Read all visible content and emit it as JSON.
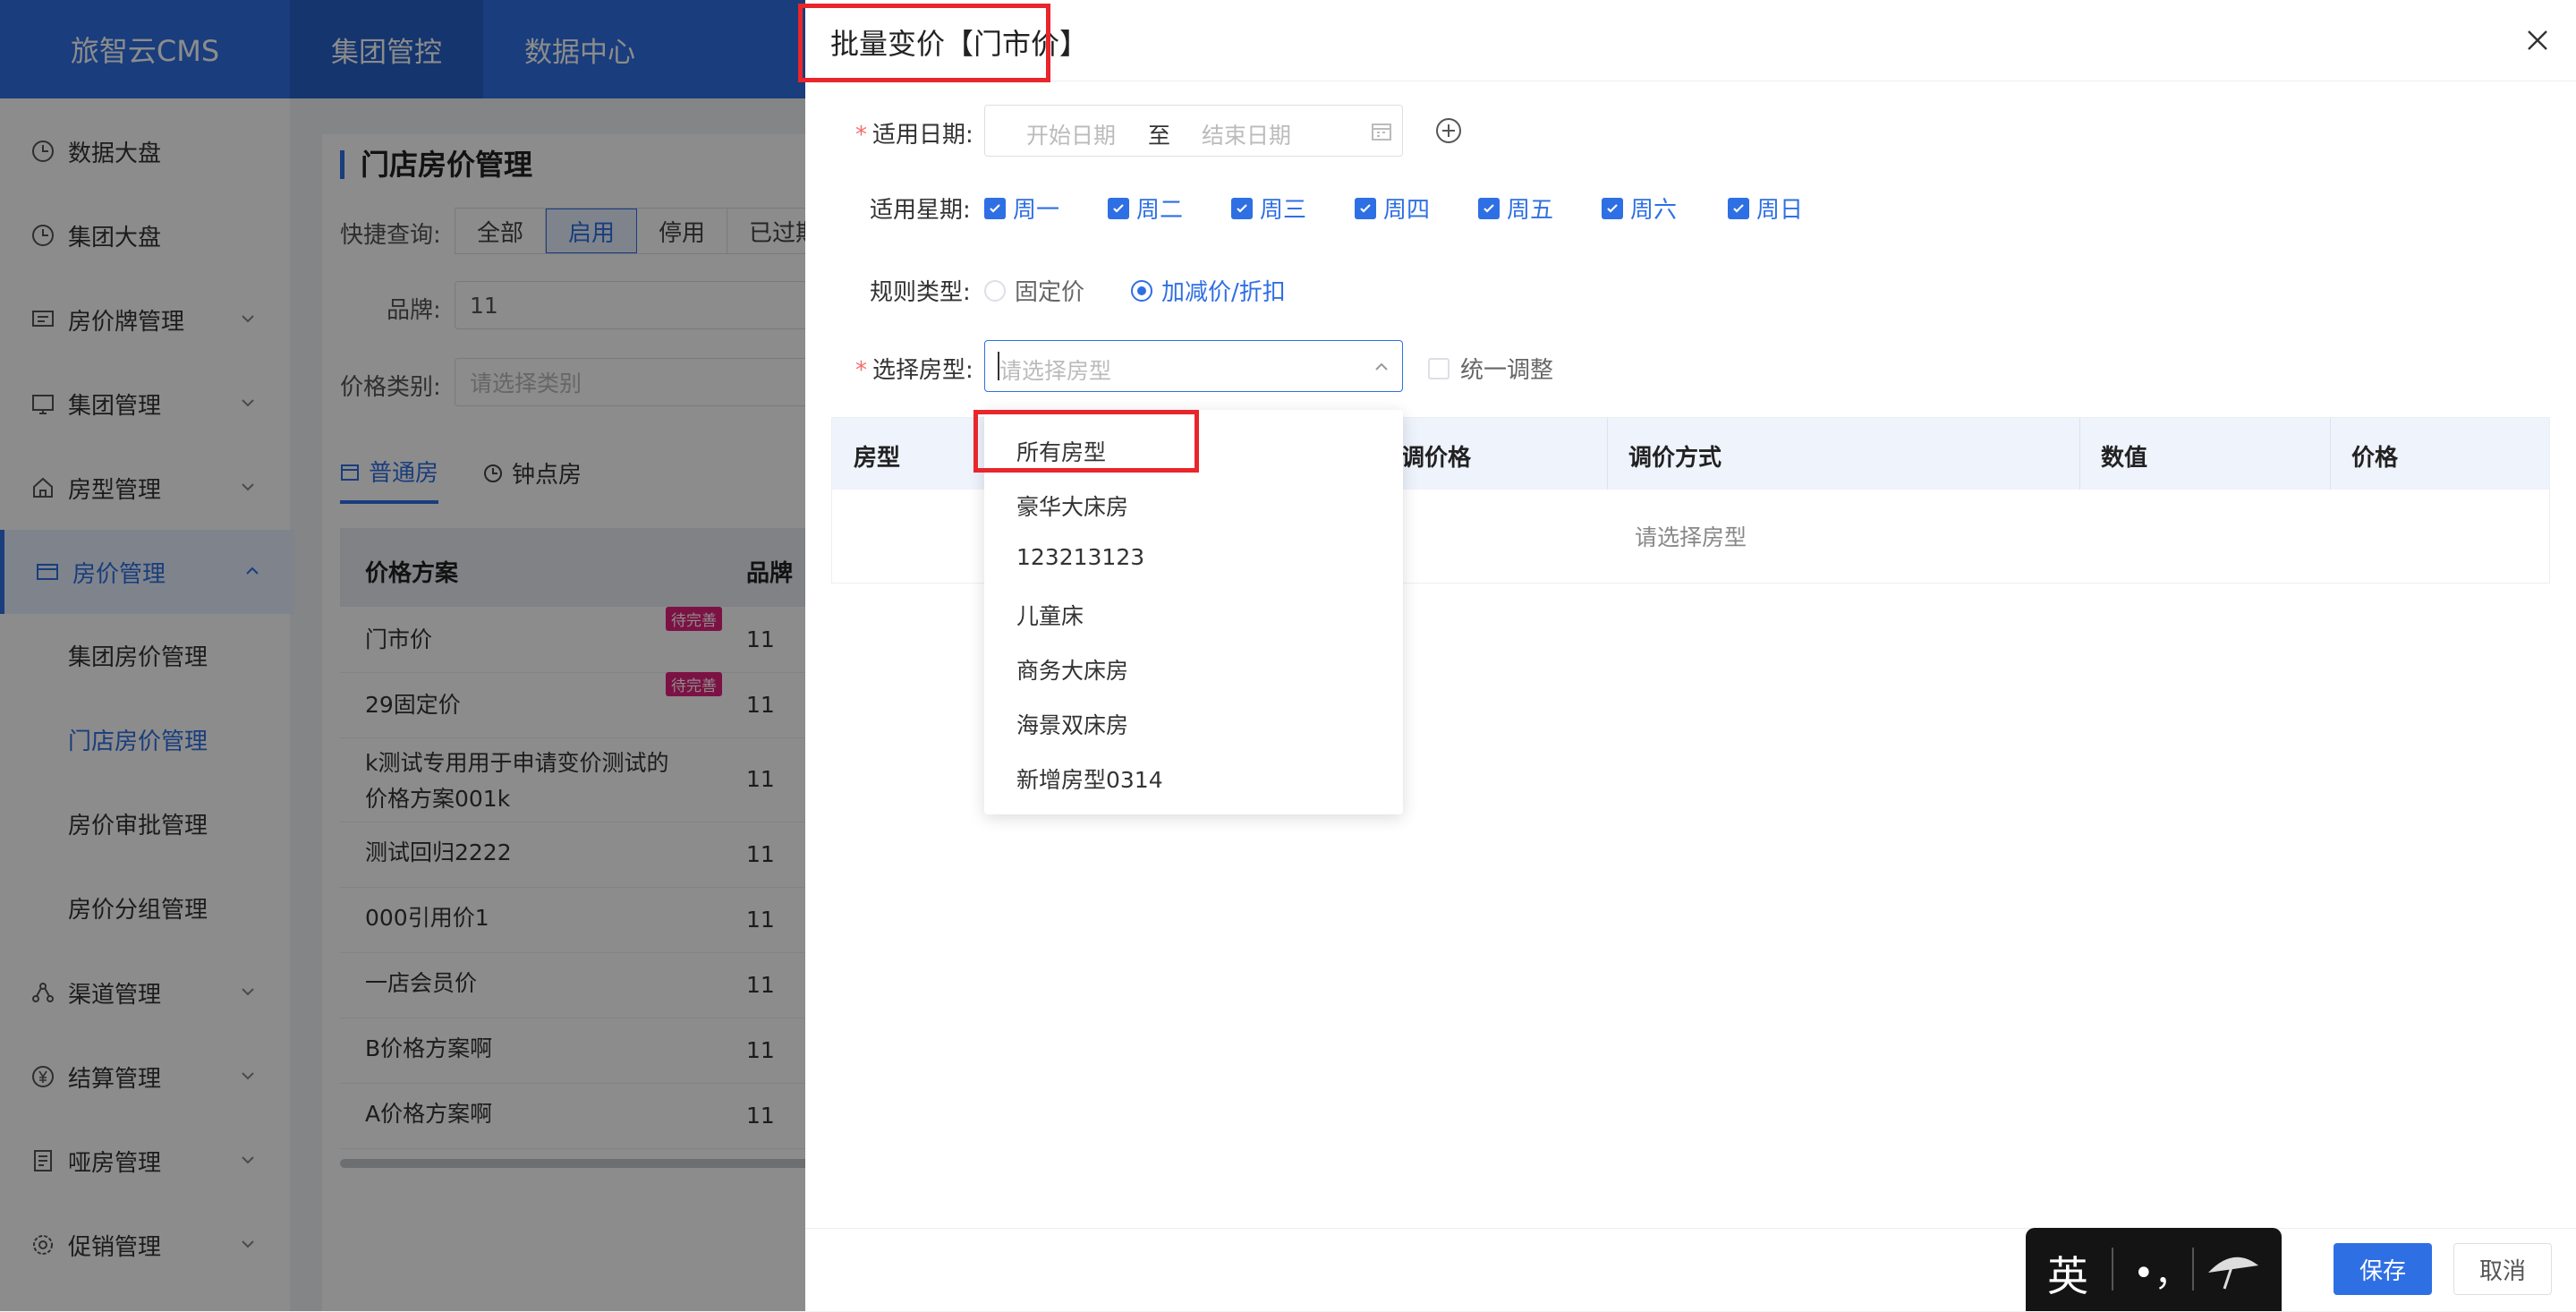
{
  "app": {
    "brand": "旅智云CMS",
    "top_nav": [
      "集团管控",
      "数据中心"
    ]
  },
  "sidebar": {
    "items": [
      {
        "label": "数据大盘",
        "icon": "clock-icon"
      },
      {
        "label": "集团大盘",
        "icon": "clock-icon"
      },
      {
        "label": "房价牌管理",
        "icon": "board-icon",
        "chevron": true
      },
      {
        "label": "集团管理",
        "icon": "board-icon",
        "chevron": true
      },
      {
        "label": "房型管理",
        "icon": "home-icon",
        "chevron": true
      },
      {
        "label": "房价管理",
        "icon": "card-icon",
        "chevron": true,
        "active": true
      },
      {
        "label": "渠道管理",
        "icon": "network-icon",
        "chevron": true
      },
      {
        "label": "结算管理",
        "icon": "yen-icon",
        "chevron": true
      },
      {
        "label": "哑房管理",
        "icon": "document-icon",
        "chevron": true
      },
      {
        "label": "促销管理",
        "icon": "gear-icon",
        "chevron": true
      }
    ],
    "sub_items": [
      "集团房价管理",
      "门店房价管理",
      "房价审批管理",
      "房价分组管理"
    ]
  },
  "main": {
    "title": "门店房价管理",
    "quick_label": "快捷查询:",
    "quick_filters": [
      "全部",
      "启用",
      "停用",
      "已过期"
    ],
    "brand_label": "品牌:",
    "brand_value": "11",
    "category_label": "价格类别:",
    "category_placeholder": "请选择类别",
    "tabs": [
      "普通房",
      "钟点房"
    ],
    "columns": [
      "价格方案",
      "品牌"
    ],
    "rows": [
      {
        "name": "门市价",
        "brand": "11",
        "badge": "待完善"
      },
      {
        "name": "29固定价",
        "brand": "11",
        "badge": "待完善"
      },
      {
        "name": "k测试专用用于申请变价测试的",
        "name2": "价格方案001k",
        "brand": "11"
      },
      {
        "name": "测试回归2222",
        "brand": "11"
      },
      {
        "name": "000引用价1",
        "brand": "11"
      },
      {
        "name": "一店会员价",
        "brand": "11"
      },
      {
        "name": "B价格方案啊",
        "brand": "11"
      },
      {
        "name": "A价格方案啊",
        "brand": "11"
      }
    ]
  },
  "drawer": {
    "title": "批量变价【门市价】",
    "date_label": "适用日期:",
    "date_start_placeholder": "开始日期",
    "date_sep": "至",
    "date_end_placeholder": "结束日期",
    "weekday_label": "适用星期:",
    "weekdays": [
      "周一",
      "周二",
      "周三",
      "周四",
      "周五",
      "周六",
      "周日"
    ],
    "rule_label": "规则类型:",
    "rule_options": [
      "固定价",
      "加减价/折扣"
    ],
    "rule_selected": "加减价/折扣",
    "roomtype_label": "选择房型:",
    "roomtype_placeholder": "请选择房型",
    "unify_label": "统一调整",
    "table_columns": [
      "房型",
      "调价格",
      "调价方式",
      "数值",
      "价格"
    ],
    "table_empty": "请选择房型",
    "dropdown_options": [
      "所有房型",
      "豪华大床房",
      "123213123",
      "儿童床",
      "商务大床房",
      "海景双床房",
      "新增房型0314"
    ],
    "save_label": "保存",
    "cancel_label": "取消"
  },
  "ime": {
    "mode_char": "英",
    "punct": "•，"
  },
  "colors": {
    "primary": "#2f6fe4",
    "highlight": "#e8262b",
    "badge": "#e2217d",
    "required": "#f56c6c"
  }
}
